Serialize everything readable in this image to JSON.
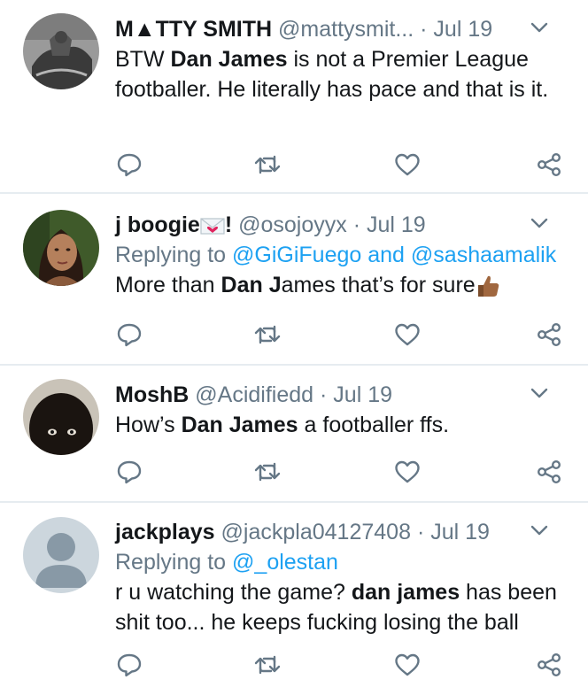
{
  "colors": {
    "name": "#14171a",
    "meta": "#657786",
    "link": "#1da1f2",
    "divider": "#e6ecf0"
  },
  "tweets": [
    {
      "author": "M▲TTY SMITH",
      "handle": "@mattysmit...",
      "date": "· Jul 19",
      "text_a": "BTW ",
      "text_b": "Dan James",
      "text_c": " is not a Premier League footballer. He literally has pace and that is it.",
      "avatar_icon": "statue-photo-avatar"
    },
    {
      "author": "j boogie",
      "author_suffix": "!",
      "handle": "@osojoyyx",
      "date": "· Jul 19",
      "reply_prefix": "Replying to ",
      "reply_user1": "@GiGiFuego",
      "reply_and": " and ",
      "reply_user2": "@sashaamalik",
      "text_a": "More than ",
      "text_b": "Dan J",
      "text_c": "ames that’s for sure",
      "avatar_icon": "woman-photo-avatar",
      "emoji_icons": [
        "envelope-heart-icon",
        "thumbs-up-icon"
      ]
    },
    {
      "author": "MoshB",
      "handle": "@Acidifiedd",
      "date": "· Jul 19",
      "text_a": "How’s ",
      "text_b": "Dan James",
      "text_c": " a footballer ffs.",
      "avatar_icon": "dark-face-photo-avatar"
    },
    {
      "author": "jackplays",
      "handle": "@jackpla04127408",
      "date": "· Jul 19",
      "reply_prefix": "Replying to ",
      "reply_user1": "@_olestan",
      "text_a": "r u watching the game? ",
      "text_b": "dan james",
      "text_c": " has been shit too... he keeps fucking losing the ball",
      "avatar_icon": "default-user-avatar"
    }
  ],
  "action_icons": [
    "reply-icon",
    "retweet-icon",
    "like-icon",
    "share-icon"
  ]
}
